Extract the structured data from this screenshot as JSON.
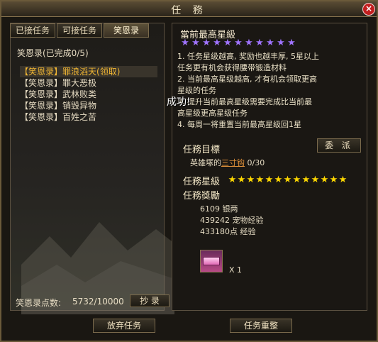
{
  "window": {
    "title": "任 務",
    "close_label": "×"
  },
  "tabs": [
    {
      "label": "已接任务",
      "active": false
    },
    {
      "label": "可接任务",
      "active": false
    },
    {
      "label": "笑恩录",
      "active": true
    }
  ],
  "left_panel": {
    "list_title": "笑恩录(已完成0/5)",
    "quests": [
      {
        "tag": "【笑恩录】",
        "name": "罪浪滔天(领取)",
        "selected": true
      },
      {
        "tag": "【笑恩录】",
        "name": "罪大恶极",
        "selected": false
      },
      {
        "tag": "【笑恩录】",
        "name": "武林败类",
        "selected": false
      },
      {
        "tag": "【笑恩录】",
        "name": "销毁异物",
        "selected": false
      },
      {
        "tag": "【笑恩录】",
        "name": "百姓之苦",
        "selected": false
      }
    ],
    "points_label": "笑恩录点数:",
    "points_value": "5732/10000",
    "copy_button": "抄 录"
  },
  "right_panel": {
    "current_title": "當前最高星級",
    "purple_star_count": 11,
    "rules": [
      "1. 任务星级越高, 奖励也越丰厚, 5星以上",
      "   任务更有机会获得腰带锻造材料",
      "2. 当前最高星级越高, 才有机会领取更高",
      "   星级的任务",
      "3. 提升当前最高星级需要完成比当前最",
      "   高星级更高星级任务",
      "4. 每周一将重置当前最高星级回1星"
    ],
    "success_text": "成功!",
    "target_label": "任務目標",
    "dispatch_button": "委 派",
    "target_prefix": "英雄塚的",
    "target_link": "三寸钩",
    "target_progress": "0/30",
    "star_label": "任務星級",
    "gold_star_count": 13,
    "reward_label": "任務獎勵",
    "rewards": [
      "6109  银两",
      "439242  宠物经验",
      "433180点  经验"
    ],
    "item_qty": "X 1"
  },
  "bottom": {
    "abandon_button": "放弃任务",
    "reset_button": "任务重整"
  },
  "colors": {
    "selected_quest": "#f2b733",
    "purple_star": "#9f73ff",
    "gold_star": "#ffd800",
    "link": "#e0913a"
  }
}
